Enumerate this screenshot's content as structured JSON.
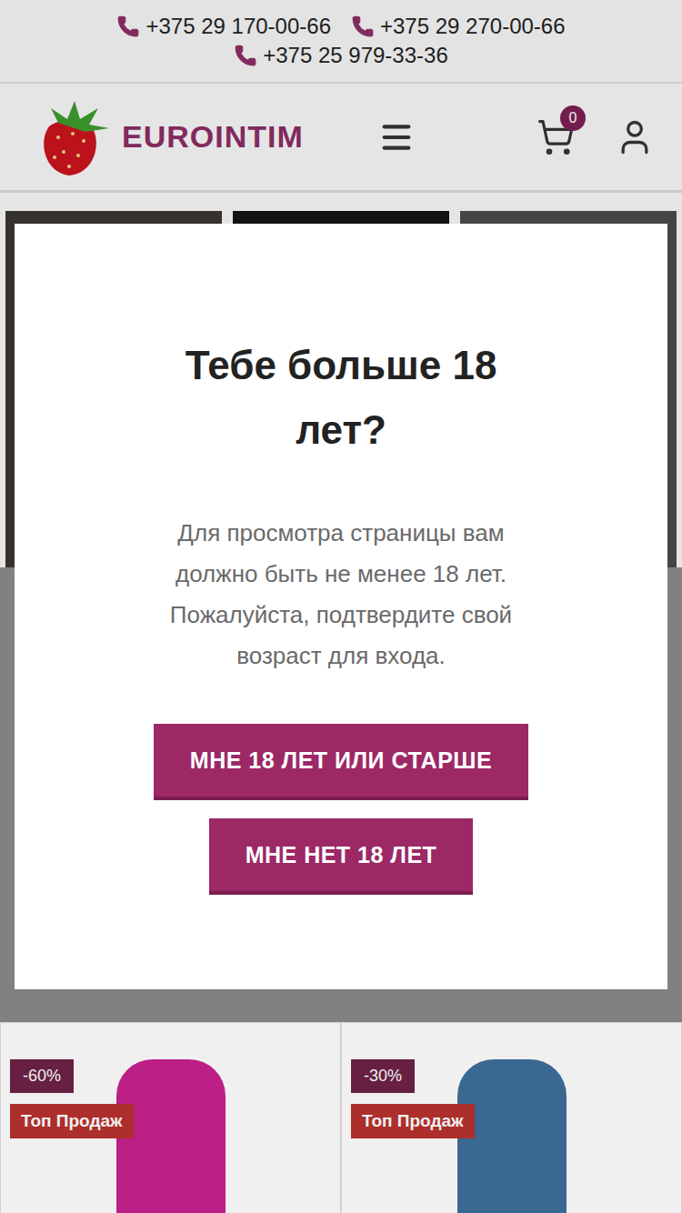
{
  "top_bar": {
    "phones": [
      "+375 29 170-00-66",
      "+375 29 270-00-66",
      "+375 25 979-33-36"
    ]
  },
  "header": {
    "logo": "EUROINTIM",
    "cart_count": "0"
  },
  "banners": [
    {
      "tone": "#3a3530"
    },
    {
      "tone": "#151515"
    },
    {
      "tone": "#4a4a48"
    }
  ],
  "products": [
    {
      "discount": "-60%",
      "badge": "Топ Продаж",
      "color": "#c8218f"
    },
    {
      "discount": "-30%",
      "badge": "Топ Продаж",
      "color": "#3d6f9a"
    }
  ],
  "modal": {
    "title": "Тебе больше 18 лет?",
    "text": "Для просмотра страницы вам должно быть не менее 18 лет. Пожалуйста, подтвердите свой возраст для входа.",
    "buttons": [
      "МНЕ 18 ЛЕТ ИЛИ СТАРШЕ",
      "МНЕ НЕТ 18 ЛЕТ"
    ]
  }
}
